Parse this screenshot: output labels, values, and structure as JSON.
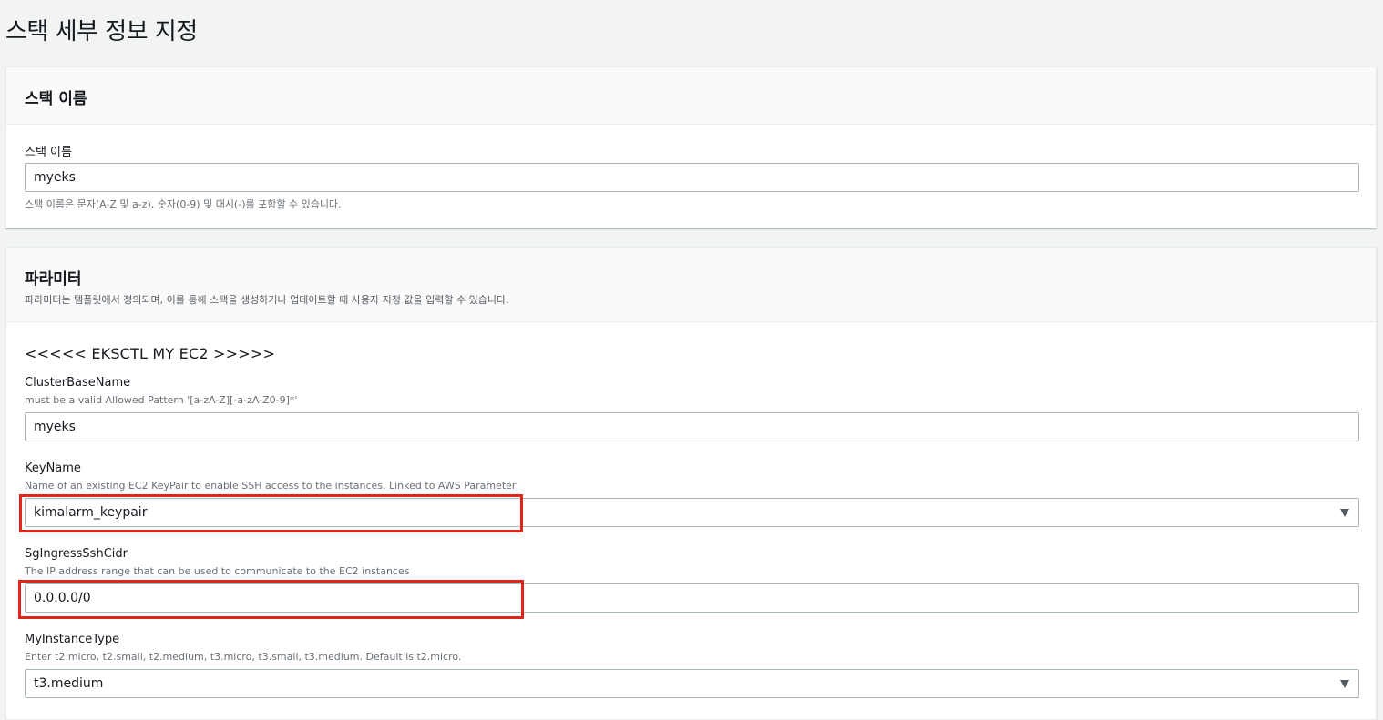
{
  "page": {
    "title": "스택 세부 정보 지정"
  },
  "stack_name_section": {
    "header": "스택 이름",
    "field_label": "스택 이름",
    "value": "myeks",
    "hint": "스택 이름은 문자(A-Z 및 a-z), 숫자(0-9) 및 대시(-)를 포함할 수 있습니다."
  },
  "parameters_section": {
    "header": "파라미터",
    "description": "파라미터는 템플릿에서 정의되며, 이를 통해 스택을 생성하거나 업데이트할 때 사용자 지정 값을 입력할 수 있습니다.",
    "group_title": "<<<<< EKSCTL MY EC2 >>>>>",
    "fields": [
      {
        "label": "ClusterBaseName",
        "hint": "must be a valid Allowed Pattern '[a-zA-Z][-a-zA-Z0-9]*'",
        "value": "myeks",
        "type": "text"
      },
      {
        "label": "KeyName",
        "hint": "Name of an existing EC2 KeyPair to enable SSH access to the instances. Linked to AWS Parameter",
        "value": "kimalarm_keypair",
        "type": "select"
      },
      {
        "label": "SgIngressSshCidr",
        "hint": "The IP address range that can be used to communicate to the EC2 instances",
        "value": "0.0.0.0/0",
        "type": "text"
      },
      {
        "label": "MyInstanceType",
        "hint": "Enter t2.micro, t2.small, t2.medium, t3.micro, t3.small, t3.medium. Default is t2.micro.",
        "value": "t3.medium",
        "type": "select"
      }
    ]
  },
  "colors": {
    "highlight": "#e0261b",
    "background": "#f2f3f3"
  },
  "icons": {
    "select_caret": "caret-down-icon"
  }
}
